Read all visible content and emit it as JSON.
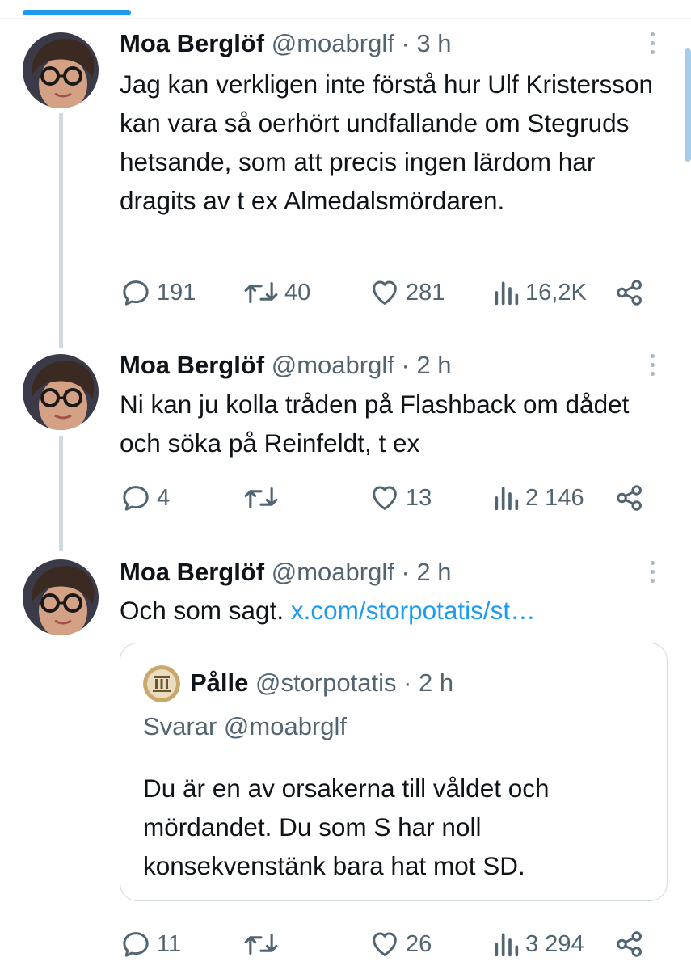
{
  "tweets": [
    {
      "name": "Moa Berglöf",
      "handle_time": "@moabrglf · 3 h",
      "text": "Jag kan verkligen inte förstå hur Ulf Kristersson kan vara så oerhört undfallande om Stegruds hetsande, som att precis ingen lärdom har dragits av t ex Almedalsmördaren.",
      "replies": "191",
      "retweets": "40",
      "likes": "281",
      "views": "16,2K"
    },
    {
      "name": "Moa Berglöf",
      "handle_time": "@moabrglf · 2 h",
      "text": "Ni kan ju kolla tråden på Flashback om dådet och söka på Reinfeldt, t ex",
      "replies": "4",
      "retweets": "",
      "likes": "13",
      "views": "2 146"
    },
    {
      "name": "Moa Berglöf",
      "handle_time": "@moabrglf · 2 h",
      "text": "Och som sagt.",
      "link": "x.com/storpotatis/st…",
      "replies": "11",
      "retweets": "",
      "likes": "26",
      "views": "3 294",
      "quote": {
        "name": "Pålle",
        "handle_time": "@storpotatis · 2 h",
        "reply_to": "Svarar @moabrglf",
        "text": "Du är en av orsakerna till våldet och mördandet. Du som S har noll konsekvenstänk bara hat mot SD."
      }
    }
  ],
  "colors": {
    "link": "#1d9bf0",
    "secondary_text": "#536471",
    "thread_line": "#cfd9de"
  }
}
